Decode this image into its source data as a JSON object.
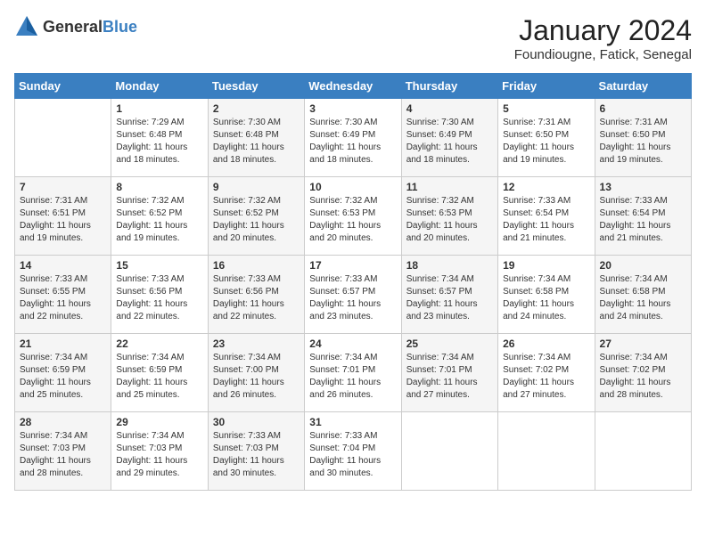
{
  "header": {
    "logo_general": "General",
    "logo_blue": "Blue",
    "month": "January 2024",
    "location": "Foundiougne, Fatick, Senegal"
  },
  "days_of_week": [
    "Sunday",
    "Monday",
    "Tuesday",
    "Wednesday",
    "Thursday",
    "Friday",
    "Saturday"
  ],
  "weeks": [
    [
      {
        "day": "",
        "info": ""
      },
      {
        "day": "1",
        "info": "Sunrise: 7:29 AM\nSunset: 6:48 PM\nDaylight: 11 hours\nand 18 minutes."
      },
      {
        "day": "2",
        "info": "Sunrise: 7:30 AM\nSunset: 6:48 PM\nDaylight: 11 hours\nand 18 minutes."
      },
      {
        "day": "3",
        "info": "Sunrise: 7:30 AM\nSunset: 6:49 PM\nDaylight: 11 hours\nand 18 minutes."
      },
      {
        "day": "4",
        "info": "Sunrise: 7:30 AM\nSunset: 6:49 PM\nDaylight: 11 hours\nand 18 minutes."
      },
      {
        "day": "5",
        "info": "Sunrise: 7:31 AM\nSunset: 6:50 PM\nDaylight: 11 hours\nand 19 minutes."
      },
      {
        "day": "6",
        "info": "Sunrise: 7:31 AM\nSunset: 6:50 PM\nDaylight: 11 hours\nand 19 minutes."
      }
    ],
    [
      {
        "day": "7",
        "info": "Sunrise: 7:31 AM\nSunset: 6:51 PM\nDaylight: 11 hours\nand 19 minutes."
      },
      {
        "day": "8",
        "info": "Sunrise: 7:32 AM\nSunset: 6:52 PM\nDaylight: 11 hours\nand 19 minutes."
      },
      {
        "day": "9",
        "info": "Sunrise: 7:32 AM\nSunset: 6:52 PM\nDaylight: 11 hours\nand 20 minutes."
      },
      {
        "day": "10",
        "info": "Sunrise: 7:32 AM\nSunset: 6:53 PM\nDaylight: 11 hours\nand 20 minutes."
      },
      {
        "day": "11",
        "info": "Sunrise: 7:32 AM\nSunset: 6:53 PM\nDaylight: 11 hours\nand 20 minutes."
      },
      {
        "day": "12",
        "info": "Sunrise: 7:33 AM\nSunset: 6:54 PM\nDaylight: 11 hours\nand 21 minutes."
      },
      {
        "day": "13",
        "info": "Sunrise: 7:33 AM\nSunset: 6:54 PM\nDaylight: 11 hours\nand 21 minutes."
      }
    ],
    [
      {
        "day": "14",
        "info": "Sunrise: 7:33 AM\nSunset: 6:55 PM\nDaylight: 11 hours\nand 22 minutes."
      },
      {
        "day": "15",
        "info": "Sunrise: 7:33 AM\nSunset: 6:56 PM\nDaylight: 11 hours\nand 22 minutes."
      },
      {
        "day": "16",
        "info": "Sunrise: 7:33 AM\nSunset: 6:56 PM\nDaylight: 11 hours\nand 22 minutes."
      },
      {
        "day": "17",
        "info": "Sunrise: 7:33 AM\nSunset: 6:57 PM\nDaylight: 11 hours\nand 23 minutes."
      },
      {
        "day": "18",
        "info": "Sunrise: 7:34 AM\nSunset: 6:57 PM\nDaylight: 11 hours\nand 23 minutes."
      },
      {
        "day": "19",
        "info": "Sunrise: 7:34 AM\nSunset: 6:58 PM\nDaylight: 11 hours\nand 24 minutes."
      },
      {
        "day": "20",
        "info": "Sunrise: 7:34 AM\nSunset: 6:58 PM\nDaylight: 11 hours\nand 24 minutes."
      }
    ],
    [
      {
        "day": "21",
        "info": "Sunrise: 7:34 AM\nSunset: 6:59 PM\nDaylight: 11 hours\nand 25 minutes."
      },
      {
        "day": "22",
        "info": "Sunrise: 7:34 AM\nSunset: 6:59 PM\nDaylight: 11 hours\nand 25 minutes."
      },
      {
        "day": "23",
        "info": "Sunrise: 7:34 AM\nSunset: 7:00 PM\nDaylight: 11 hours\nand 26 minutes."
      },
      {
        "day": "24",
        "info": "Sunrise: 7:34 AM\nSunset: 7:01 PM\nDaylight: 11 hours\nand 26 minutes."
      },
      {
        "day": "25",
        "info": "Sunrise: 7:34 AM\nSunset: 7:01 PM\nDaylight: 11 hours\nand 27 minutes."
      },
      {
        "day": "26",
        "info": "Sunrise: 7:34 AM\nSunset: 7:02 PM\nDaylight: 11 hours\nand 27 minutes."
      },
      {
        "day": "27",
        "info": "Sunrise: 7:34 AM\nSunset: 7:02 PM\nDaylight: 11 hours\nand 28 minutes."
      }
    ],
    [
      {
        "day": "28",
        "info": "Sunrise: 7:34 AM\nSunset: 7:03 PM\nDaylight: 11 hours\nand 28 minutes."
      },
      {
        "day": "29",
        "info": "Sunrise: 7:34 AM\nSunset: 7:03 PM\nDaylight: 11 hours\nand 29 minutes."
      },
      {
        "day": "30",
        "info": "Sunrise: 7:33 AM\nSunset: 7:03 PM\nDaylight: 11 hours\nand 30 minutes."
      },
      {
        "day": "31",
        "info": "Sunrise: 7:33 AM\nSunset: 7:04 PM\nDaylight: 11 hours\nand 30 minutes."
      },
      {
        "day": "",
        "info": ""
      },
      {
        "day": "",
        "info": ""
      },
      {
        "day": "",
        "info": ""
      }
    ]
  ]
}
